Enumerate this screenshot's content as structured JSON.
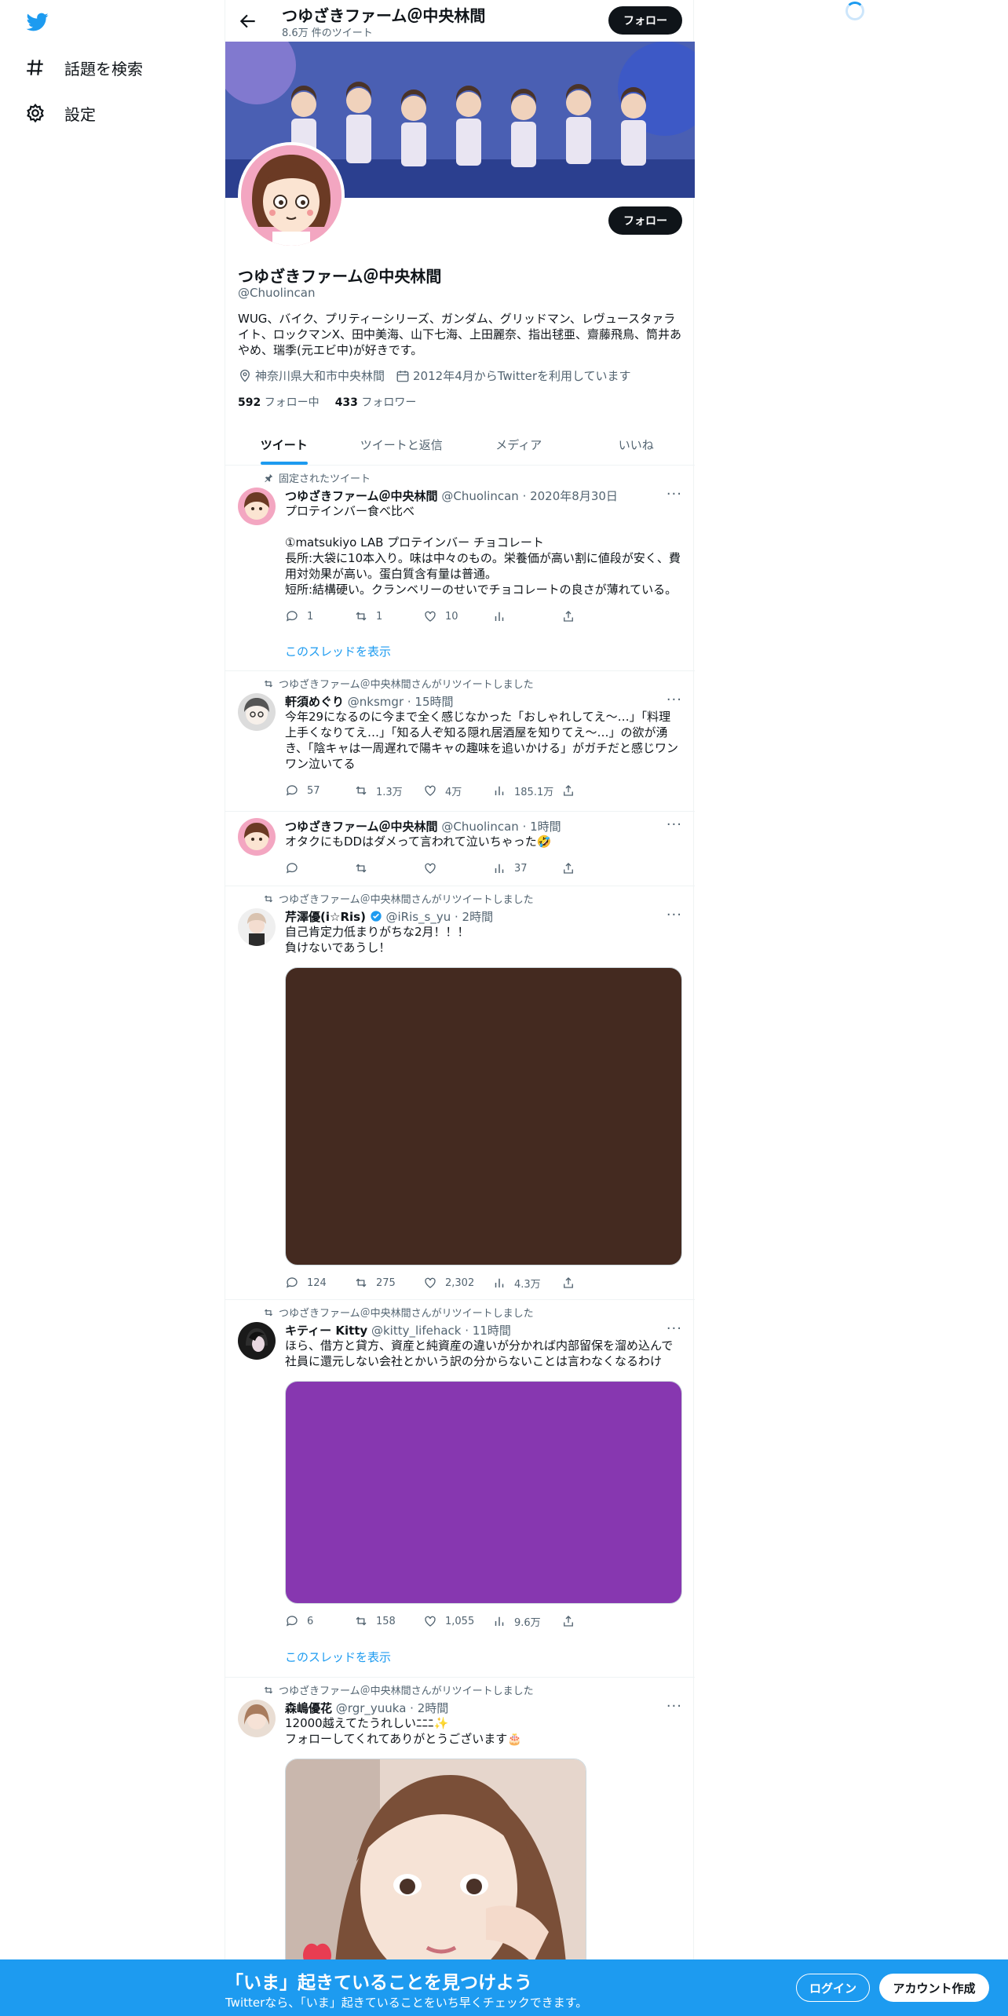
{
  "nav": {
    "explore_label": "話題を検索",
    "settings_label": "設定"
  },
  "header": {
    "name": "つゆざきファーム＠中央林間",
    "tweet_count": "8.6万 件のツイート",
    "follow_label": "フォロー"
  },
  "profile": {
    "name": "つゆざきファーム＠中央林間",
    "handle": "@Chuolincan",
    "bio": "WUG、バイク、プリティーシリーズ、ガンダム、グリッドマン、レヴュースタァライト、ロックマンX、田中美海、山下七海、上田麗奈、指出毬亜、齋藤飛鳥、筒井あやめ、瑞季(元エビ中)が好きです。",
    "location": "神奈川県大和市中央林間",
    "joined": "2012年4月からTwitterを利用しています",
    "following_count": "592",
    "following_label": "フォロー中",
    "followers_count": "433",
    "followers_label": "フォロワー",
    "follow_label": "フォロー"
  },
  "tabs": [
    {
      "label": "ツイート"
    },
    {
      "label": "ツイートと返信"
    },
    {
      "label": "メディア"
    },
    {
      "label": "いいね"
    }
  ],
  "tweets": [
    {
      "context": "固定されたツイート",
      "name": "つゆざきファーム＠中央林間",
      "handle": "@Chuolincan · 2020年8月30日",
      "text": "プロテインバー食べ比べ\n\n①matsukiyo LAB プロテインバー チョコレート\n長所:大袋に10本入り。味は中々のもの。栄養価が高い割に値段が安く、費用対効果が高い。蛋白質含有量は普通。\n短所:結構硬い。クランベリーのせいでチョコレートの良さが薄れている。",
      "replies": "1",
      "retweets": "1",
      "likes": "10",
      "views": "",
      "thread": "このスレッドを表示"
    },
    {
      "context": "つゆざきファーム＠中央林間さんがリツイートしました",
      "name": "軒須めぐり",
      "handle": "@nksmgr · 15時間",
      "text": "今年29になるのに今まで全く感じなかった「おしゃれしてえ〜…」「料理上手くなりてえ…」「知る人ぞ知る隠れ居酒屋を知りてえ〜…」の欲が湧き、「陰キャは一周遅れで陽キャの趣味を追いかける」がガチだと感じワンワン泣いてる",
      "replies": "57",
      "retweets": "1.3万",
      "likes": "4万",
      "views": "185.1万"
    },
    {
      "context": "",
      "name": "つゆざきファーム＠中央林間",
      "handle": "@Chuolincan · 1時間",
      "text": "オタクにもDDはダメって言われて泣いちゃった🤣",
      "replies": "",
      "retweets": "",
      "likes": "",
      "views": "37"
    },
    {
      "context": "つゆざきファーム＠中央林間さんがリツイートしました",
      "name": "芹澤優(i☆Ris)",
      "handle": "@iRis_s_yu · 2時間",
      "text": "自己肯定力低まりがちな2月！！！\n負けないであうし！",
      "replies": "124",
      "retweets": "275",
      "likes": "2,302",
      "views": "4.3万",
      "media_color": "#442a20"
    },
    {
      "context": "つゆざきファーム＠中央林間さんがリツイートしました",
      "name": "キティー Kitty",
      "handle": "@kitty_lifehack · 11時間",
      "text": "ほら、借方と貸方、資産と純資産の違いが分かれば内部留保を溜め込んで社員に還元しない会社とかいう訳の分からないことは言わなくなるわけ",
      "replies": "6",
      "retweets": "158",
      "likes": "1,055",
      "views": "9.6万",
      "media_color": "#8737b0",
      "thread": "このスレッドを表示"
    },
    {
      "context": "つゆざきファーム＠中央林間さんがリツイートしました",
      "name": "森嶋優花",
      "handle": "@rgr_yuuka · 2時間",
      "text": "12000越えてたうれしいﾆﾆﾆ✨\nフォローしてくれてありがとうございます🎂"
    }
  ],
  "banner_bottom": {
    "title": "「いま」起きていることを見つけよう",
    "subtitle": "Twitterなら、「いま」起きていることをいち早くチェックできます。",
    "login": "ログイン",
    "signup": "アカウント作成"
  },
  "colors": {
    "accent": "#1d9bf0",
    "text": "#0f1419",
    "muted": "#536471"
  }
}
